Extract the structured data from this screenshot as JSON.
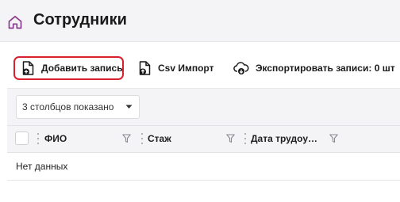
{
  "header": {
    "title": "Сотрудники"
  },
  "toolbar": {
    "add_label": "Добавить запись",
    "csv_label": "Csv Импорт",
    "export_label": "Экспортировать записи: 0 шт"
  },
  "grid": {
    "columns_selector": "3 столбцов показано",
    "columns": [
      {
        "label": "ФИО"
      },
      {
        "label": "Стаж"
      },
      {
        "label": "Дата трудоу…"
      }
    ],
    "empty_text": "Нет данных"
  },
  "colors": {
    "accent_purple": "#8b3a8f",
    "highlight_red": "#d9202e"
  },
  "icons": {
    "home": "home-icon",
    "add": "file-plus-icon",
    "csv": "file-import-icon",
    "export": "cloud-download-icon",
    "filter": "filter-icon",
    "dropdown": "chevron-down-icon"
  }
}
